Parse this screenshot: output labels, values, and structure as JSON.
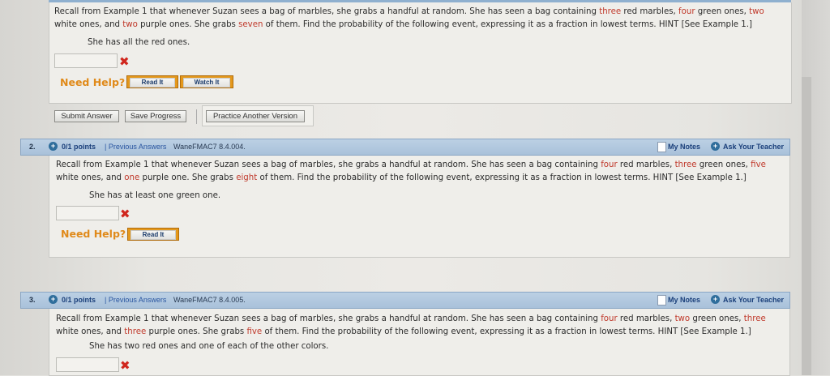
{
  "question1": {
    "text_parts": [
      {
        "t": "Recall from Example 1 that whenever Suzan sees a bag of marbles, she grabs a handful at random. She has seen a bag containing ",
        "red": false
      },
      {
        "t": "three",
        "red": true
      },
      {
        "t": " red marbles, ",
        "red": false
      },
      {
        "t": "four",
        "red": true
      },
      {
        "t": " green ones, ",
        "red": false
      },
      {
        "t": "two",
        "red": true
      }
    ],
    "text_line2_parts": [
      {
        "t": "white ones, and ",
        "red": false
      },
      {
        "t": "two",
        "red": true
      },
      {
        "t": " purple ones. She grabs ",
        "red": false
      },
      {
        "t": "seven",
        "red": true
      },
      {
        "t": " of them. Find the probability of the following event, expressing it as a fraction in lowest terms. HINT [See Example 1.]",
        "red": false
      }
    ],
    "event": "She has all the red ones.",
    "answer_value": "",
    "wrong_mark": "✖",
    "need_help": "Need Help?",
    "read_it": "Read It",
    "watch_it": "Watch It",
    "submit_answer": "Submit Answer",
    "save_progress": "Save Progress",
    "practice_another": "Practice Another Version"
  },
  "question2": {
    "number": "2.",
    "points": "0/1 points",
    "previous_answers": "| Previous Answers",
    "code": "WaneFMAC7 8.4.004.",
    "my_notes": "My Notes",
    "ask_teacher": "Ask Your Teacher",
    "text_parts": [
      {
        "t": "Recall from Example 1 that whenever Suzan sees a bag of marbles, she grabs a handful at random. She has seen a bag containing ",
        "red": false
      },
      {
        "t": "four",
        "red": true
      },
      {
        "t": " red marbles, ",
        "red": false
      },
      {
        "t": "three",
        "red": true
      },
      {
        "t": " green ones, ",
        "red": false
      },
      {
        "t": "five",
        "red": true
      }
    ],
    "text_line2_parts": [
      {
        "t": "white ones, and ",
        "red": false
      },
      {
        "t": "one",
        "red": true
      },
      {
        "t": " purple one. She grabs ",
        "red": false
      },
      {
        "t": "eight",
        "red": true
      },
      {
        "t": " of them. Find the probability of the following event, expressing it as a fraction in lowest terms. HINT [See Example 1.]",
        "red": false
      }
    ],
    "event": "She has at least one green one.",
    "answer_value": "",
    "wrong_mark": "✖",
    "need_help": "Need Help?",
    "read_it": "Read It"
  },
  "question3": {
    "number": "3.",
    "points": "0/1 points",
    "previous_answers": "| Previous Answers",
    "code": "WaneFMAC7 8.4.005.",
    "my_notes": "My Notes",
    "ask_teacher": "Ask Your Teacher",
    "text_parts": [
      {
        "t": "Recall from Example 1 that whenever Suzan sees a bag of marbles, she grabs a handful at random. She has seen a bag containing ",
        "red": false
      },
      {
        "t": "four",
        "red": true
      },
      {
        "t": " red marbles, ",
        "red": false
      },
      {
        "t": "two",
        "red": true
      },
      {
        "t": " green ones, ",
        "red": false
      },
      {
        "t": "three",
        "red": true
      }
    ],
    "text_line2_parts": [
      {
        "t": "white ones, and ",
        "red": false
      },
      {
        "t": "three",
        "red": true
      },
      {
        "t": " purple ones. She grabs ",
        "red": false
      },
      {
        "t": "five",
        "red": true
      },
      {
        "t": " of them. Find the probability of the following event, expressing it as a fraction in lowest terms. HINT [See Example 1.]",
        "red": false
      }
    ],
    "event": "She has two red ones and one of each of the other colors.",
    "answer_value": "",
    "wrong_mark": "✖"
  },
  "icons": {
    "plus": "plus-circle-icon",
    "notes": "note-icon",
    "wrong": "x-mark-icon"
  },
  "colors": {
    "red_value": "#c0392b",
    "help_orange": "#e08a1a",
    "header_blue": "#a9c1da",
    "link_blue": "#1a3f7a"
  }
}
